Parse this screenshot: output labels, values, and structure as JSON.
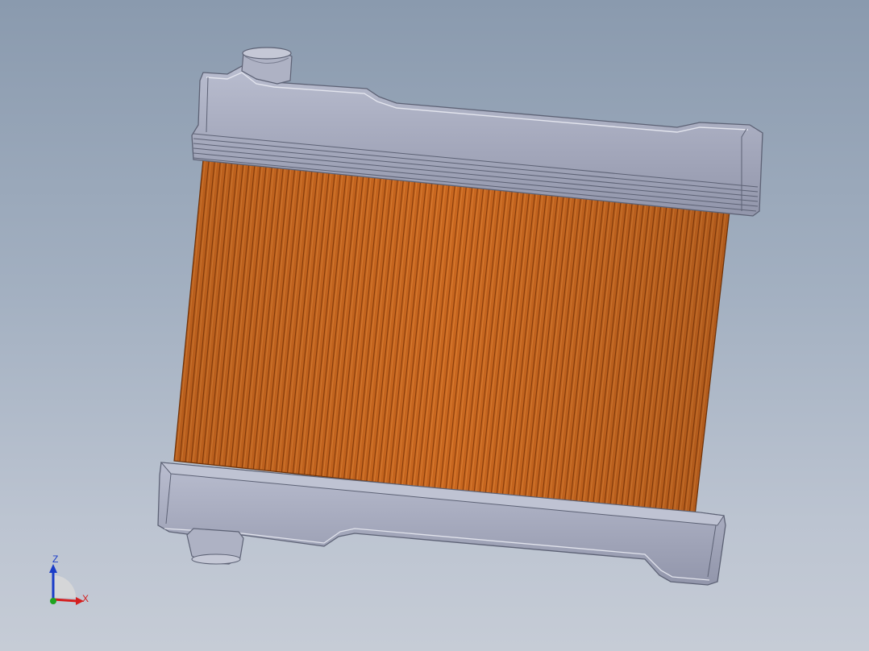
{
  "viewport": {
    "background_top": "#8a9aae",
    "background_bottom": "#c6ccd6"
  },
  "model": {
    "name": "radiator",
    "colors": {
      "core_fins": "#c8661f",
      "core_fin_dark": "#8a3f0c",
      "core_fin_light": "#e28a3c",
      "tank_face": "#a2a7bd",
      "tank_top": "#b8bccd",
      "tank_edge": "#5d6275"
    }
  },
  "triad": {
    "z_label": "Z",
    "x_label": "X",
    "colors": {
      "z": "#1a3cc8",
      "x": "#d41f1f",
      "y": "#1fa31f",
      "sector": "#d8d8d8"
    }
  }
}
